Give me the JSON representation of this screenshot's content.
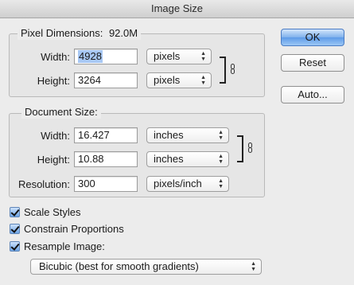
{
  "window": {
    "title": "Image Size"
  },
  "pixel_dimensions": {
    "legend": "Pixel Dimensions:",
    "size": "92.0M",
    "width_label": "Width:",
    "width_value": "4928",
    "width_unit": "pixels",
    "height_label": "Height:",
    "height_value": "3264",
    "height_unit": "pixels"
  },
  "document_size": {
    "legend": "Document Size:",
    "width_label": "Width:",
    "width_value": "16.427",
    "width_unit": "inches",
    "height_label": "Height:",
    "height_value": "10.88",
    "height_unit": "inches",
    "resolution_label": "Resolution:",
    "resolution_value": "300",
    "resolution_unit": "pixels/inch"
  },
  "options": {
    "scale_styles": {
      "label": "Scale Styles",
      "checked": true
    },
    "constrain_proportions": {
      "label": "Constrain Proportions",
      "checked": true
    },
    "resample_image": {
      "label": "Resample Image:",
      "checked": true
    },
    "resample_method": "Bicubic (best for smooth gradients)"
  },
  "buttons": {
    "ok": "OK",
    "reset": "Reset",
    "auto": "Auto..."
  },
  "icons": [
    "chain-link-icon",
    "popup-arrows-icon",
    "checkmark-icon"
  ],
  "colors": {
    "accent": "#5e9be8",
    "selection": "#a8c8f4",
    "background": "#ececec"
  }
}
